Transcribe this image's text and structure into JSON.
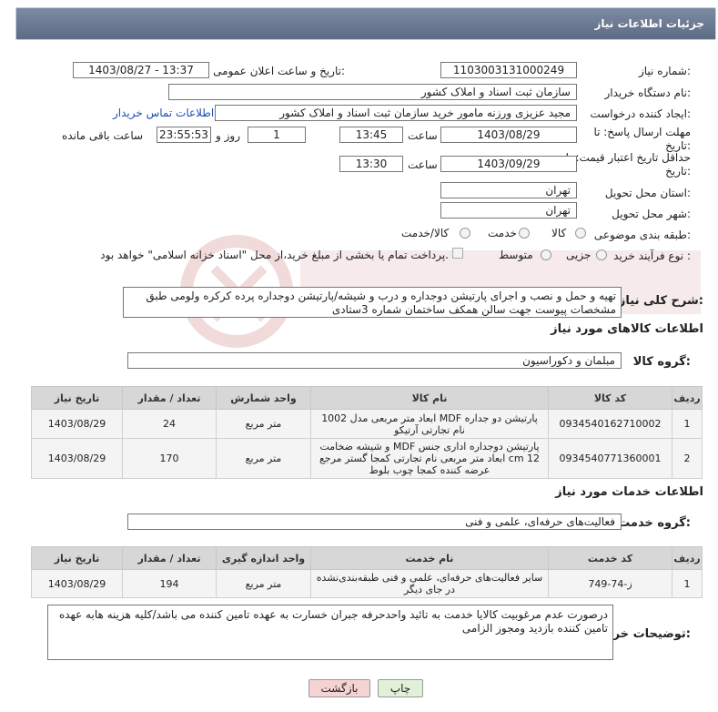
{
  "header": {
    "title": "جزئیات اطلاعات نیاز"
  },
  "form": {
    "need_number_label": "شماره نیاز:",
    "need_number": "1103003131000249",
    "announce_label": "تاریخ و ساعت اعلان عمومی:",
    "announce_value": "1403/08/27 - 13:37",
    "buyer_org_label": "نام دستگاه خریدار:",
    "buyer_org": "سازمان ثبت اسناد و املاک کشور",
    "requester_label": "ایجاد کننده درخواست:",
    "requester": "مجید عزیزی ورزنه مامور خرید سازمان ثبت اسناد و املاک کشور",
    "contact_link": "اطلاعات تماس خریدار",
    "deadline_label_1": "مهلت ارسال پاسخ: تا",
    "deadline_label_2": "تاریخ:",
    "deadline_date": "1403/08/29",
    "time_label": "ساعت",
    "deadline_time": "13:45",
    "days_value": "1",
    "days_label": "روز و",
    "remaining_time": "23:55:53",
    "remaining_label": "ساعت باقی مانده",
    "validity_label_1": "حداقل تاریخ اعتبار قیمت: تا",
    "validity_label_2": "تاریخ:",
    "validity_date": "1403/09/29",
    "validity_time_label": "ساعت",
    "validity_time": "13:30",
    "province_label": "استان محل تحویل:",
    "province": "تهران",
    "city_label": "شهر محل تحویل:",
    "city": "تهران",
    "category_label": "طبقه بندی موضوعی:",
    "category_options": [
      "کالا",
      "خدمت",
      "کالا/خدمت"
    ],
    "process_label": "نوع فرآیند خرید :",
    "process_options": [
      "جزیی",
      "متوسط"
    ],
    "payment_note": "پرداخت تمام یا بخشی از مبلغ خرید،از محل \"اسناد خزانه اسلامی\" خواهد بود.",
    "description_label": "شرح کلی نیاز:",
    "description": "تهیه و حمل و نصب و اجرای پارتیشن دوجداره و درب و شیشه/پارتیشن دوجداره پرده کرکره ولومی طبق مشخصات پیوست جهت سالن همکف ساختمان شماره 3ستادی"
  },
  "goods": {
    "section_title": "اطلاعات کالاهای مورد نیاز",
    "group_label": "گروه کالا:",
    "group_value": "مبلمان و دکوراسیون",
    "columns": [
      "ردیف",
      "کد کالا",
      "نام کالا",
      "واحد شمارش",
      "تعداد / مقدار",
      "تاریخ نیاز"
    ],
    "rows": [
      {
        "row": "1",
        "code": "0934540162710002",
        "name": "پارتیشن دو جداره MDF ابعاد متر مربعی مدل 1002 نام تجارتی آرتیکو",
        "unit": "متر مربع",
        "qty": "24",
        "date": "1403/08/29"
      },
      {
        "row": "2",
        "code": "0934540771360001",
        "name": "پارتیشن دوجداره اداری جنس MDF و شیشه ضخامت 12 cm ابعاد متر مربعی نام تجارتی کمجا گستر مرجع عرضه کننده کمجا چوب بلوط",
        "unit": "متر مربع",
        "qty": "170",
        "date": "1403/08/29"
      }
    ]
  },
  "services": {
    "section_title": "اطلاعات خدمات مورد نیاز",
    "group_label": "گروه خدمت:",
    "group_value": "فعالیت‌های حرفه‌ای، علمی و فنی",
    "columns": [
      "ردیف",
      "کد خدمت",
      "نام خدمت",
      "واحد اندازه گیری",
      "تعداد / مقدار",
      "تاریخ نیاز"
    ],
    "rows": [
      {
        "row": "1",
        "code": "ز-74-749",
        "name": "سایر فعالیت‌های حرفه‌ای، علمی و فنی طبقه‌بندی‌نشده در جای دیگر",
        "unit": "متر مربع",
        "qty": "194",
        "date": "1403/08/29"
      }
    ]
  },
  "buyer_notes": {
    "label": "توضیحات خریدار:",
    "text": "درصورت عدم مرغوبیت کالایا خدمت به تائید واحدحرفه جبران خسارت به عهده تامین کننده می باشد/کلیه هزینه هابه عهده تامین کننده بازدید ومجوز الزامی"
  },
  "buttons": {
    "print": "چاپ",
    "back": "بازگشت"
  },
  "colors": {
    "header": "#6b7893",
    "link": "#1a4fb5",
    "back_button": "#f6d3d3",
    "print_button": "#e3f0d8"
  }
}
